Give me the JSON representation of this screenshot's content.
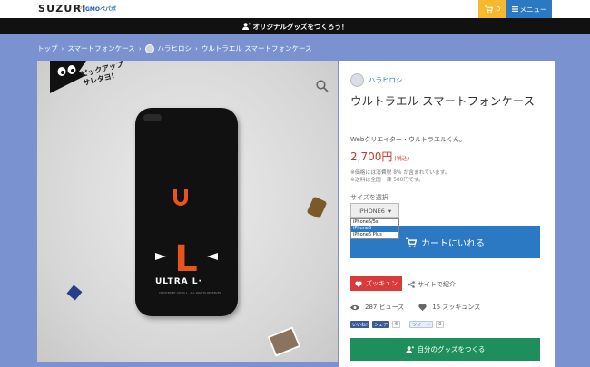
{
  "header": {
    "logo": "SUZURI",
    "logo_by": "by",
    "logo_gmo": "GMOペパボ",
    "cart_count": "0",
    "menu_label": "メニュー"
  },
  "promo_bar": {
    "label": "オリジナルグッズをつくろう！"
  },
  "breadcrumb": [
    "トップ",
    "スマートフォンケース",
    "ハラヒロシ",
    "ウルトラエル スマートフォンケース"
  ],
  "image_panel": {
    "pickup_line1": "ピックアップ",
    "pickup_line2": "サレタヨ!",
    "phone_brand": "ULTRA L·",
    "phone_letter": "L",
    "phone_small_text": "CREATED BY ULTRA L · ALL RIGHTS RESERVED"
  },
  "product": {
    "creator_name": "ハラヒロシ",
    "title": "ウルトラエル スマートフォンケース",
    "description": "Webクリエイター・ウルトラエルくん。",
    "price": "2,700円",
    "price_tax": "(税込)",
    "note_tax": "※価格には消費税 8% が含まれています。",
    "note_shipping": "※送料は全国一律 500円です。",
    "size_label": "サイズを選択",
    "size_selected": "IPHONE6",
    "size_options": [
      "iPhone5/5s",
      "iPhone6",
      "iPhone6 Plus"
    ],
    "size_selected_index": 1,
    "cart_button": "カートにいれる",
    "favorite_button": "ズッキュン",
    "share_link": "サイトで紹介",
    "views": "287 ビューズ",
    "likes": "15 ズッキュンズ",
    "fb_like": "いいね!",
    "fb_share": "シェア",
    "fb_count": "6",
    "tweet": "ツイート",
    "tweet_count": "0",
    "make_button": "自分のグッズをつくる"
  },
  "colors": {
    "background": "#7a93d0",
    "accent_blue": "#2b79c2",
    "cart_yellow": "#f5b82e",
    "favorite_red": "#d93a3a",
    "make_green": "#1e8f5a",
    "price_red": "#c0392b",
    "phone_orange": "#e8541e"
  },
  "icons": {
    "cart": "cart-icon",
    "menu": "hamburger-icon",
    "zoom": "search-icon",
    "heart": "heart-icon",
    "share": "share-icon",
    "eye": "eye-icon",
    "user_add": "add-user-icon"
  }
}
